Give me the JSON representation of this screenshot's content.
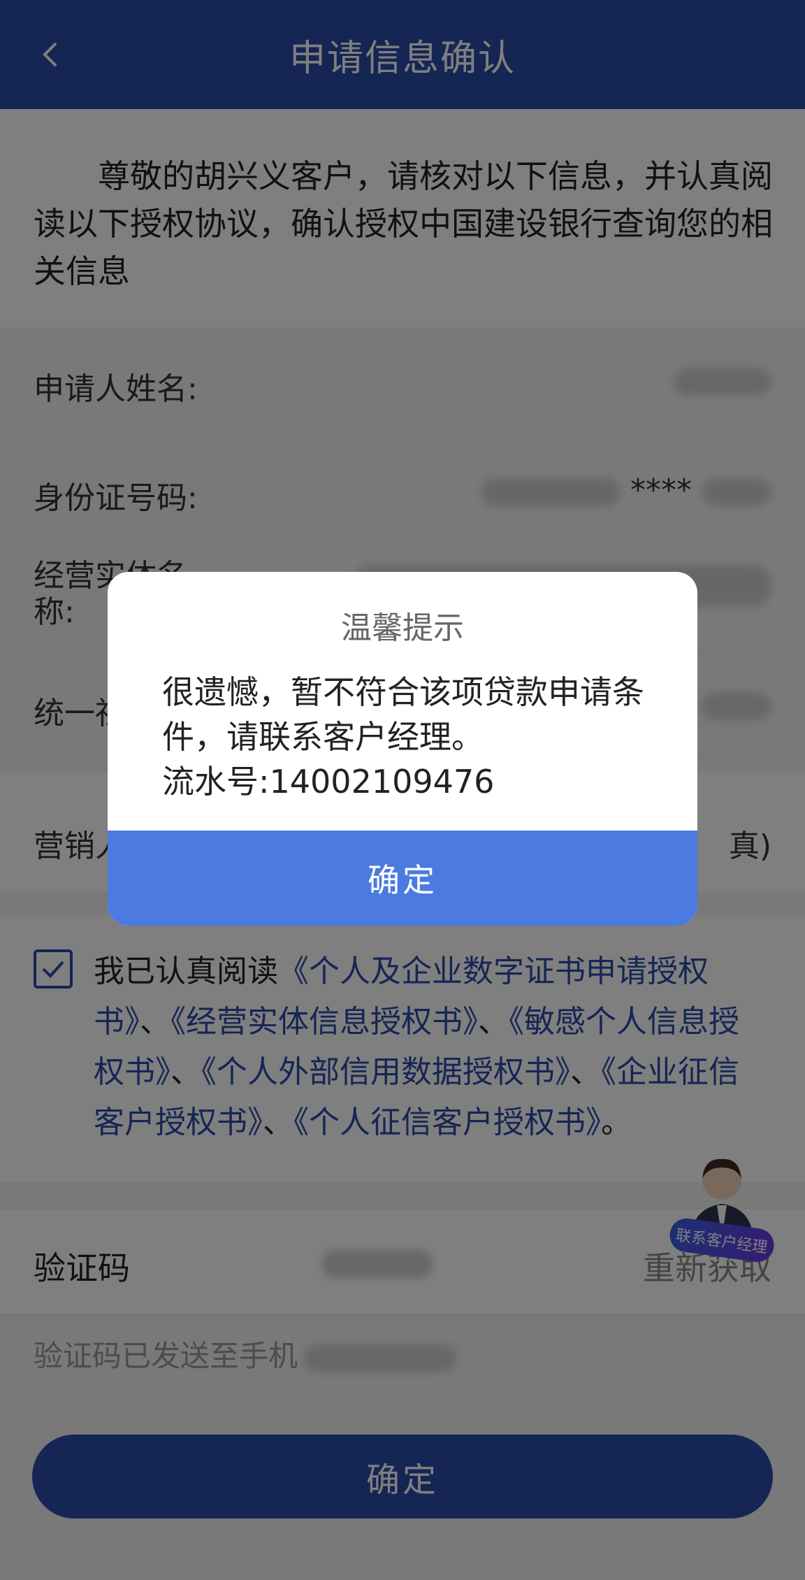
{
  "header": {
    "title": "申请信息确认"
  },
  "intro": {
    "text": "尊敬的胡兴义客户，请核对以下信息，并认真阅读以下授权协议，确认授权中国建设银行查询您的相关信息"
  },
  "info": {
    "rows": [
      {
        "label": "申请人姓名:"
      },
      {
        "label": "身份证号码:",
        "value_visible": "****"
      },
      {
        "label": "经营实体名称:"
      },
      {
        "label": "统一社"
      }
    ],
    "marketing_label": "营销人",
    "marketing_value_tail": "真)"
  },
  "agreement": {
    "prefix": "我已认真阅读",
    "docs": [
      "《个人及企业数字证书申请授权书》",
      "《经营实体信息授权书》",
      "《敏感个人信息授权书》",
      "《个人外部信用数据授权书》",
      "《企业征信客户授权书》",
      "《个人征信客户授权书》"
    ],
    "separator": "、",
    "suffix": "。"
  },
  "verify": {
    "label": "验证码",
    "resend": "重新获取",
    "sent_note": "验证码已发送至手机"
  },
  "main_button": {
    "label": "确定"
  },
  "manager": {
    "badge": "联系客户经理"
  },
  "dialog": {
    "title": "温馨提示",
    "message_line1": "很遗憾，暂不符合该项贷款申请条件，请联系客户经理。",
    "serial": "流水号:14002109476",
    "confirm": "确定"
  },
  "colors": {
    "brand": "#2a4aa8",
    "dialog_button": "#4b7be0",
    "overlay": "rgba(0,0,0,0.5)"
  }
}
